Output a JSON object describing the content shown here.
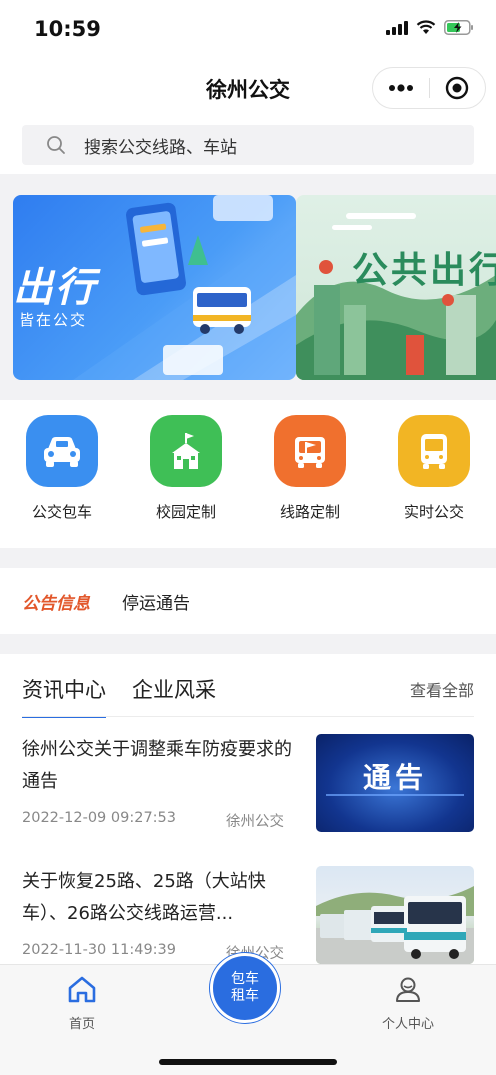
{
  "status": {
    "time": "10:59"
  },
  "nav": {
    "title": "徐州公交"
  },
  "search": {
    "placeholder": "搜索公交线路、车站"
  },
  "banners": [
    {
      "title": "出行",
      "subtitle": "皆在公交"
    },
    {
      "title": "公共出行"
    }
  ],
  "quick_actions": [
    {
      "label": "公交包车",
      "color": "#3a8ff0",
      "icon": "car-icon"
    },
    {
      "label": "校园定制",
      "color": "#3fbf56",
      "icon": "school-icon"
    },
    {
      "label": "线路定制",
      "color": "#f0702e",
      "icon": "route-flag-icon"
    },
    {
      "label": "实时公交",
      "color": "#f2b524",
      "icon": "bus-icon"
    }
  ],
  "notice": {
    "tag": "公告信息",
    "text": "停运通告"
  },
  "news": {
    "tabs": [
      "资讯中心",
      "企业风采"
    ],
    "see_all": "查看全部",
    "items": [
      {
        "title": "徐州公交关于调整乘车防疫要求的通告",
        "date": "2022-12-09 09:27:53",
        "source": "徐州公交",
        "thumb_text": "通告"
      },
      {
        "title": "关于恢复25路、25路（大站快车）、26路公交线路运营...",
        "date": "2022-11-30 11:49:39",
        "source": "徐州公交",
        "thumb_text": ""
      }
    ]
  },
  "tab_bar": {
    "home": "首页",
    "center_line1": "包车",
    "center_line2": "租车",
    "profile": "个人中心"
  },
  "colors": {
    "accent": "#2a6de0",
    "notice_tag": "#e2572b"
  }
}
